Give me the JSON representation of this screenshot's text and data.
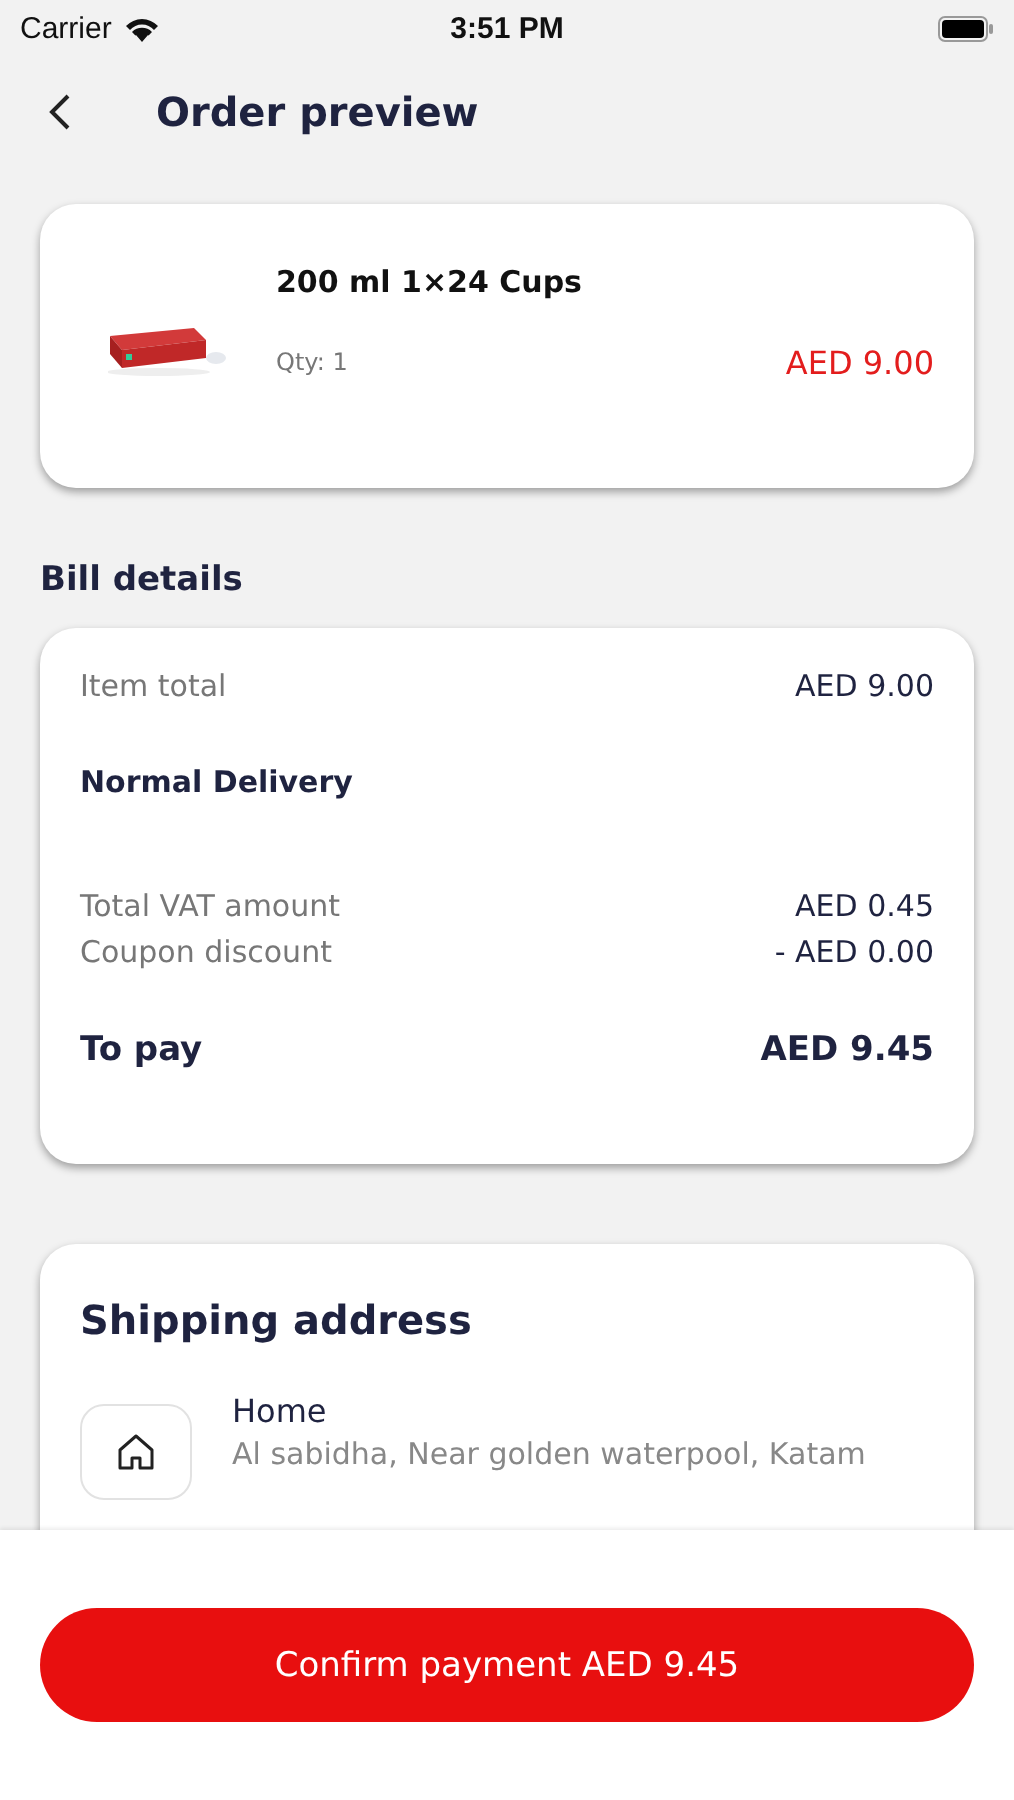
{
  "status_bar": {
    "carrier": "Carrier",
    "time": "3:51 PM"
  },
  "header": {
    "title": "Order preview"
  },
  "product": {
    "name": "200 ml 1×24 Cups",
    "qty": "Qty: 1",
    "price": "AED 9.00"
  },
  "bill": {
    "title": "Bill details",
    "rows": [
      {
        "kind": "line",
        "label": "Item total",
        "value": "AED 9.00"
      },
      {
        "kind": "heading",
        "label": "Normal Delivery"
      },
      {
        "kind": "line",
        "label": "Total VAT amount",
        "value": "AED 0.45"
      },
      {
        "kind": "line",
        "label": "Coupon discount",
        "value": "- AED 0.00"
      },
      {
        "kind": "total",
        "label": "To pay",
        "value": "AED 9.45"
      }
    ]
  },
  "shipping": {
    "title": "Shipping address",
    "name": "Home",
    "address": "Al sabidha, Near golden waterpool, Katam"
  },
  "confirm_button": "Confirm payment AED 9.45"
}
